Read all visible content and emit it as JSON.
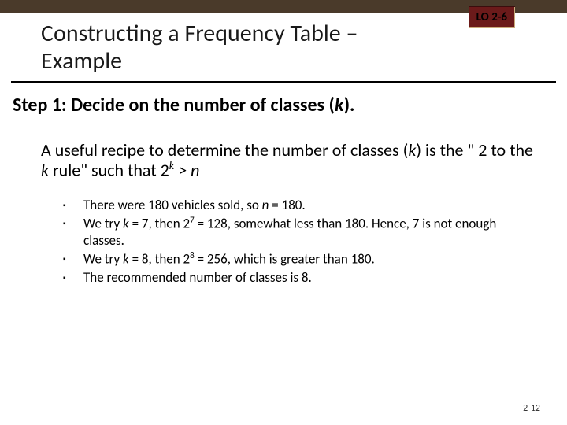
{
  "lo_badge": "LO 2-6",
  "title": "Constructing a Frequency Table – Example",
  "step_prefix": "Step 1: Decide on the number of classes (",
  "step_k": "k",
  "step_suffix": ").",
  "recipe_a": "A useful recipe to determine the number of classes (",
  "recipe_k1": "k",
  "recipe_b": ") is the \" 2 to the ",
  "recipe_k2": "k",
  "recipe_c": " rule\"  such that 2",
  "recipe_exp": "k",
  "recipe_d": " > ",
  "recipe_n": "n",
  "bullets": [
    {
      "pre": "There were 180 vehicles sold, so ",
      "ital": "n",
      "post": " = 180."
    },
    {
      "pre": "We try ",
      "ital": "k",
      "mid": " = 7, then 2",
      "sup": "7",
      "post": "  = 128, somewhat less than 180. Hence, 7 is not enough classes."
    },
    {
      "pre": "We try ",
      "ital": "k",
      "mid": " = 8, then 2",
      "sup": "8",
      "post": "  = 256, which is greater than 180."
    },
    {
      "pre": "The recommended number of classes is 8.",
      "ital": "",
      "post": ""
    }
  ],
  "page_number": "2-12"
}
